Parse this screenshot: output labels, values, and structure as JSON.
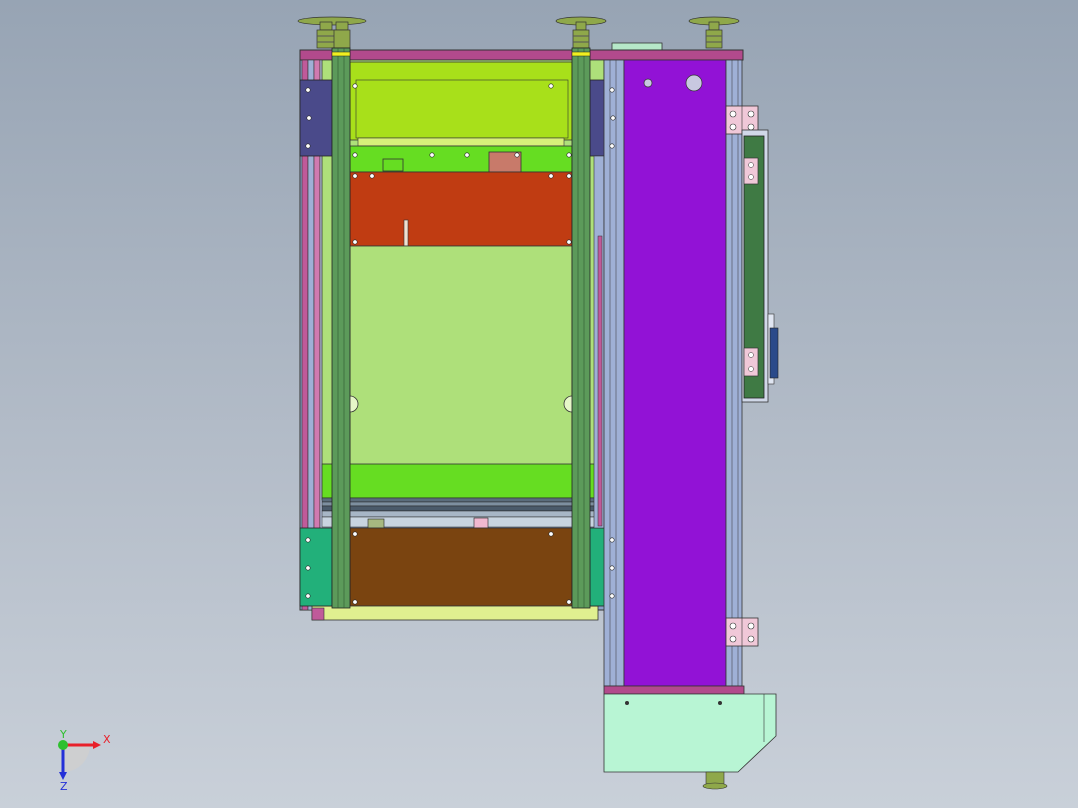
{
  "viewport": {
    "background_top": "#97a4b4",
    "background_bottom": "#c9d0d9"
  },
  "triad": {
    "x_label": "X",
    "y_label": "Y",
    "z_label": "Z",
    "x_color": "#e8202a",
    "y_color": "#2ec02e",
    "z_color": "#2430d8"
  },
  "parts": {
    "frame_rail_color": "#9fb0d6",
    "column_color": "#5c9a5a",
    "top_plate_color": "#b24a8c",
    "yellow_green_panel_color": "#a8e01a",
    "bright_green_bar_color": "#66dd22",
    "orange_panel_color": "#c03c12",
    "light_green_panel_color": "#aee07a",
    "brown_panel_color": "#7a4410",
    "purple_door_color": "#9212d6",
    "mint_box_color": "#b8f5d4",
    "side_panel_color": "#3f7a44",
    "teal_bracket_color": "#22b07a",
    "navy_bracket_color": "#4a4a8a",
    "hinge_color": "#f0c8d8",
    "levelling_foot_color": "#8fa84a"
  }
}
